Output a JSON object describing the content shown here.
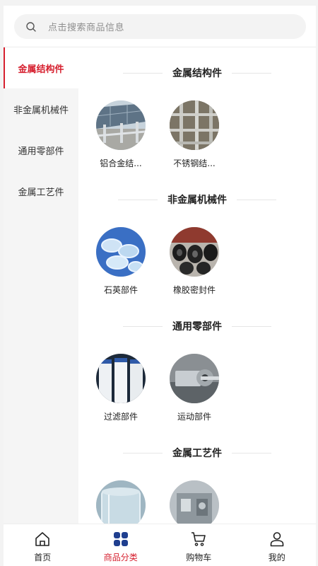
{
  "search": {
    "placeholder": "点击搜索商品信息"
  },
  "sidebar": {
    "items": [
      {
        "label": "金属结构件",
        "active": true
      },
      {
        "label": "非金属机械件",
        "active": false
      },
      {
        "label": "通用零部件",
        "active": false
      },
      {
        "label": "金属工艺件",
        "active": false
      }
    ]
  },
  "sections": [
    {
      "title": "金属结构件",
      "items": [
        {
          "name": "铝合金结...",
          "image": "solar-mount-photo"
        },
        {
          "name": "不锈钢结...",
          "image": "steel-rack-photo"
        }
      ]
    },
    {
      "title": "非金属机械件",
      "items": [
        {
          "name": "石英部件",
          "image": "quartz-parts-photo"
        },
        {
          "name": "橡胶密封件",
          "image": "rubber-seals-photo"
        }
      ]
    },
    {
      "title": "通用零部件",
      "items": [
        {
          "name": "过滤部件",
          "image": "filter-cartridges-photo"
        },
        {
          "name": "运动部件",
          "image": "motion-parts-photo"
        }
      ]
    },
    {
      "title": "金属工艺件",
      "items": [
        {
          "name": "",
          "image": "glass-cylinder-photo"
        },
        {
          "name": "",
          "image": "machinery-photo"
        }
      ]
    }
  ],
  "tabbar": {
    "items": [
      {
        "label": "首页",
        "icon": "home-icon",
        "active": false
      },
      {
        "label": "商品分类",
        "icon": "category-icon",
        "active": true
      },
      {
        "label": "购物车",
        "icon": "cart-icon",
        "active": false
      },
      {
        "label": "我的",
        "icon": "user-icon",
        "active": false
      }
    ]
  },
  "colors": {
    "accent": "#d6202f",
    "category_icon_blue": "#1f3f8f"
  }
}
